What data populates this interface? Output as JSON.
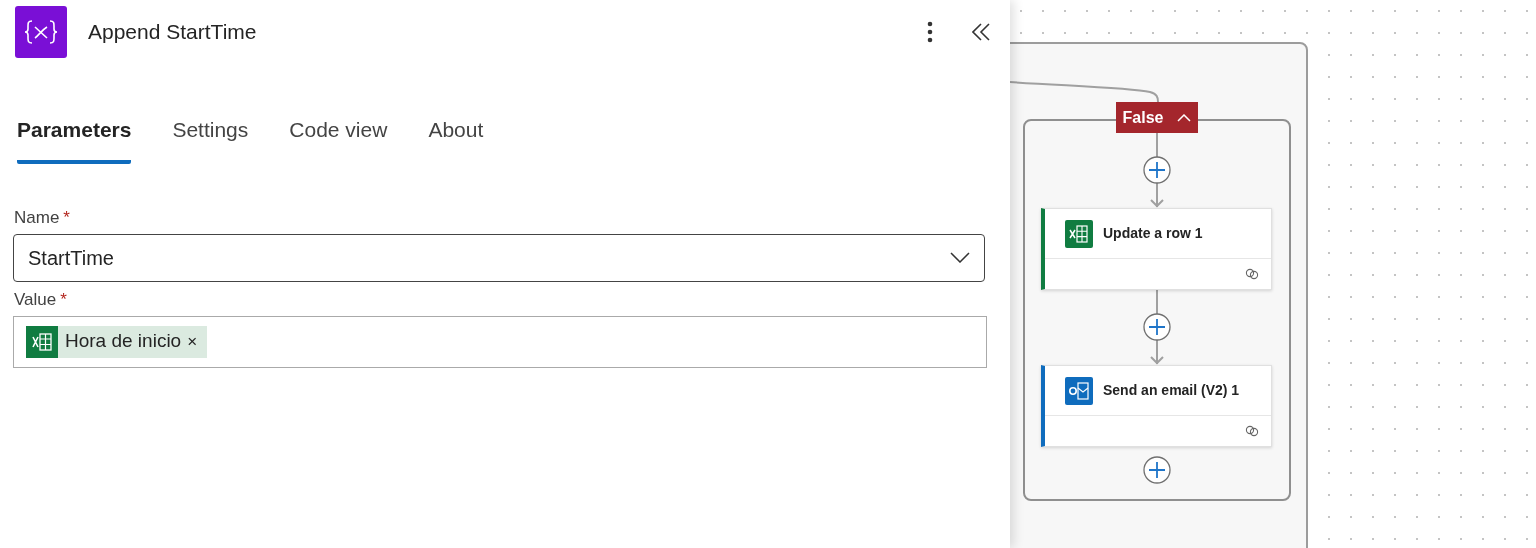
{
  "panel": {
    "title": "Append StartTime",
    "tabs": [
      {
        "label": "Parameters",
        "selected": true
      },
      {
        "label": "Settings",
        "selected": false
      },
      {
        "label": "Code view",
        "selected": false
      },
      {
        "label": "About",
        "selected": false
      }
    ],
    "fields": [
      {
        "kind": "dropdown",
        "label": "Name",
        "required_mark": "*",
        "value": "StartTime"
      },
      {
        "kind": "tokens",
        "label": "Value",
        "required_mark": "*",
        "tokens": [
          {
            "text": "Hora de inicio",
            "remove": "×"
          }
        ]
      }
    ]
  },
  "canvas": {
    "branch": {
      "label": "False",
      "expanded": true
    },
    "actions": [
      {
        "kind": "excel",
        "title": "Update a row 1"
      },
      {
        "kind": "outlook",
        "title": "Send an email (V2) 1"
      }
    ]
  }
}
